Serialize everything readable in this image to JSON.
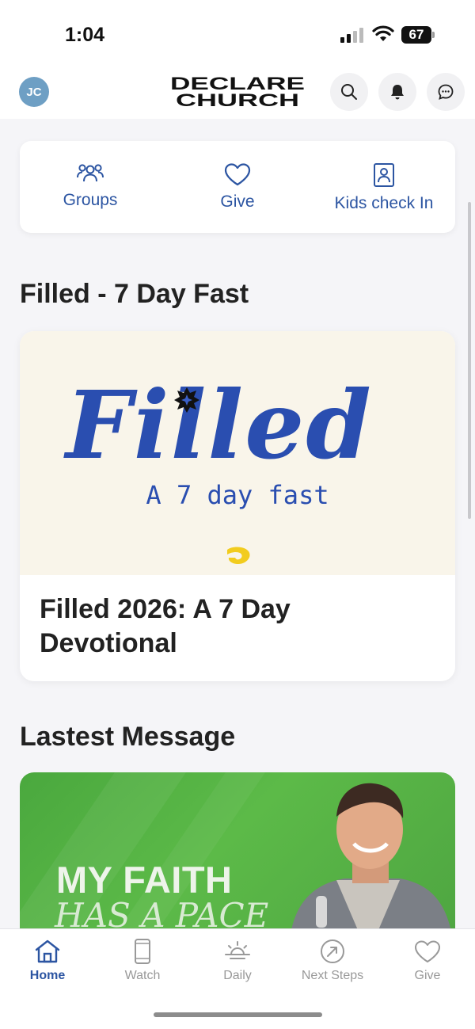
{
  "status_bar": {
    "time": "1:04",
    "battery": "67"
  },
  "header": {
    "avatar_initials": "JC",
    "logo_line1": "DECLARE",
    "logo_line2": "CHURCH",
    "icons": [
      "search-icon",
      "bell-icon",
      "chat-icon"
    ]
  },
  "quick_actions": [
    {
      "label": "Groups",
      "icon": "groups-icon"
    },
    {
      "label": "Give",
      "icon": "heart-icon"
    },
    {
      "label": "Kids check In",
      "icon": "badge-icon"
    }
  ],
  "featured": {
    "section_title": "Filled - 7 Day Fast",
    "image_title": "Filled",
    "image_subtitle": "A 7 day fast",
    "card_title": "Filled 2026: A 7 Day Devotional"
  },
  "latest": {
    "section_title": "Lastest Message",
    "line1": "MY FAITH",
    "line2": "HAS A PACE"
  },
  "tabs": [
    {
      "label": "Home",
      "icon": "home-icon",
      "active": true
    },
    {
      "label": "Watch",
      "icon": "phone-icon",
      "active": false
    },
    {
      "label": "Daily",
      "icon": "sunrise-icon",
      "active": false
    },
    {
      "label": "Next Steps",
      "icon": "arrow-circle-icon",
      "active": false
    },
    {
      "label": "Give",
      "icon": "heart-icon",
      "active": false
    }
  ],
  "colors": {
    "accent": "#2c55a2",
    "brand_blue": "#2a4eb0",
    "cream": "#f9f5ea",
    "green": "#55b243"
  }
}
